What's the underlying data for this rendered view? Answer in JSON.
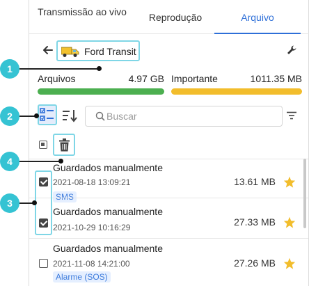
{
  "tabs": [
    {
      "label": "Transmissão ao vivo"
    },
    {
      "label": "Reprodução"
    },
    {
      "label": "Arquivo"
    }
  ],
  "header": {
    "vehicle_name": "Ford Transit"
  },
  "storage": {
    "archive": {
      "label": "Arquivos",
      "size": "4.97 GB",
      "color": "#4caf50"
    },
    "important": {
      "label": "Importante",
      "size": "1011.35 MB",
      "color": "#f2bd2c"
    }
  },
  "search": {
    "placeholder": "Buscar"
  },
  "files": [
    {
      "title": "Guardados manualmente",
      "time": "2021-08-18 13:09:21",
      "tag": "SMS",
      "size": "13.61 MB",
      "checked": true,
      "starred": true
    },
    {
      "title": "Guardados manualmente",
      "time": "2021-10-29 10:16:29",
      "tag": "",
      "size": "27.33 MB",
      "checked": true,
      "starred": true
    },
    {
      "title": "Guardados manualmente",
      "time": "2021-11-08 14:21:00",
      "tag": "Alarme (SOS)",
      "size": "27.26 MB",
      "checked": false,
      "starred": true
    }
  ],
  "callouts": [
    "1",
    "2",
    "3",
    "4"
  ],
  "icons": [
    "back-arrow-icon",
    "truck-icon",
    "wrench-icon",
    "multi-select-icon",
    "sort-icon",
    "search-icon",
    "filter-icon",
    "trash-icon",
    "star-icon"
  ],
  "colors": {
    "accent": "#2e6fd8",
    "highlight": "#7fd6e6",
    "callout": "#35c3d3",
    "star": "#f2bd2c"
  }
}
